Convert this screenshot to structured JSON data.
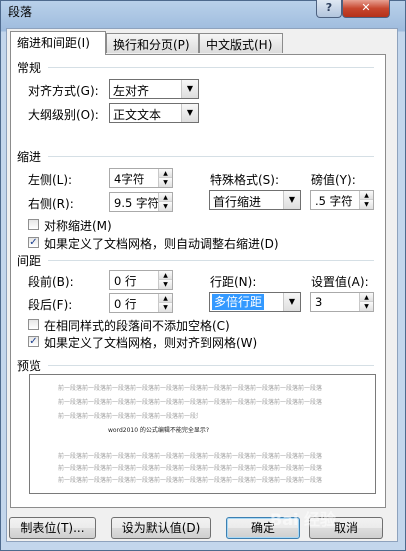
{
  "window": {
    "title": "段落"
  },
  "tabs": [
    {
      "label": "缩进和间距(I)"
    },
    {
      "label": "换行和分页(P)"
    },
    {
      "label": "中文版式(H)"
    }
  ],
  "general": {
    "heading": "常规",
    "alignment_label": "对齐方式(G):",
    "alignment_value": "左对齐",
    "outline_label": "大纲级别(O):",
    "outline_value": "正文文本"
  },
  "indent": {
    "heading": "缩进",
    "left_label": "左侧(L):",
    "left_value": "4字符",
    "right_label": "右侧(R):",
    "right_value": "9.5 字符",
    "special_label": "特殊格式(S):",
    "special_value": "首行缩进",
    "by_label": "磅值(Y):",
    "by_value": ".5 字符",
    "mirror_label": "对称缩进(M)",
    "mirror_checked": false,
    "auto_adjust_label": "如果定义了文档网格，则自动调整右缩进(D)",
    "auto_adjust_checked": true
  },
  "spacing": {
    "heading": "间距",
    "before_label": "段前(B):",
    "before_value": "0 行",
    "after_label": "段后(F):",
    "after_value": "0 行",
    "line_spacing_label": "行距(N):",
    "line_spacing_value": "多倍行距",
    "at_label": "设置值(A):",
    "at_value": "3",
    "no_space_label": "在相同样式的段落间不添加空格(C)",
    "no_space_checked": false,
    "snap_grid_label": "如果定义了文档网格，则对齐到网格(W)",
    "snap_grid_checked": true
  },
  "preview": {
    "heading": "预览",
    "sample_text": "word2010 的公式编辑不能完全显示?",
    "filler_text": "前一段落前一段落前一段落前一段落前一段落前一段落前一段落前一段落前一段落前一段落前一段落"
  },
  "buttons": {
    "tabs_label": "制表位(T)...",
    "default_label": "设为默认值(D)",
    "ok_label": "确定",
    "cancel_label": "取消"
  },
  "watermark": "Bai 经验"
}
